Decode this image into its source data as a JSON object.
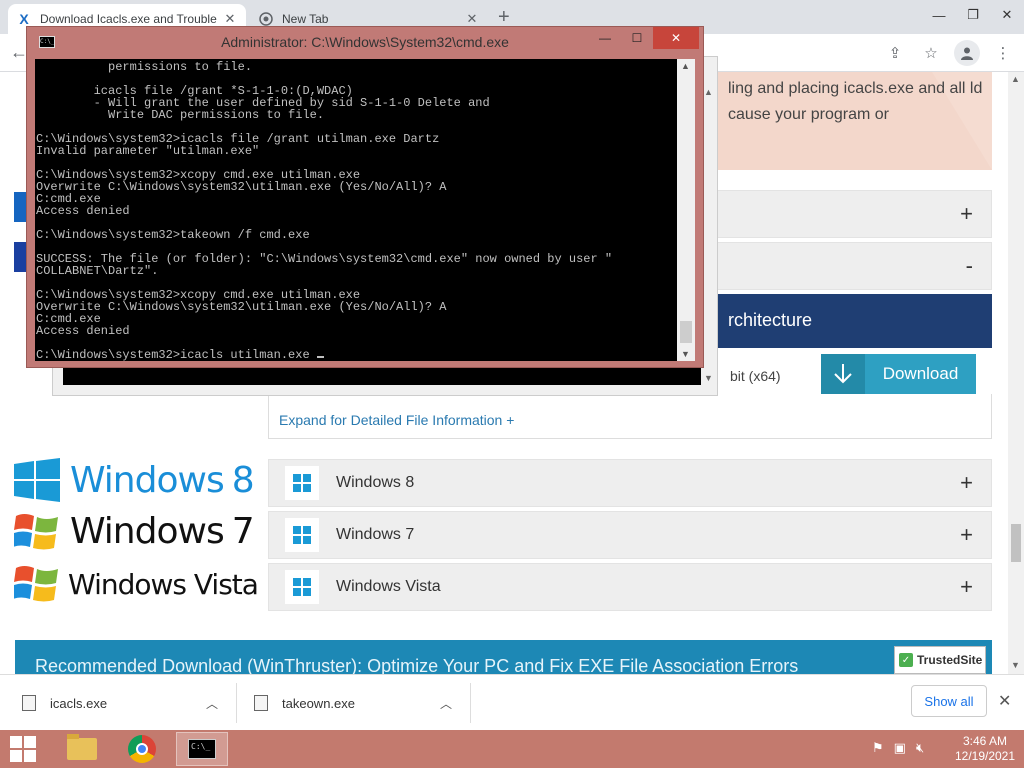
{
  "browser": {
    "tabs": [
      {
        "title": "Download Icacls.exe and Trouble",
        "active": true,
        "favicon": "x-logo-icon"
      },
      {
        "title": "New Tab",
        "active": false,
        "favicon": "chrome-icon"
      }
    ],
    "new_tab_symbol": "+",
    "window_controls": {
      "minimize": "—",
      "restore": "❐",
      "close": "✕"
    }
  },
  "page": {
    "intro_text": "ling and placing icacls.exe and all ld cause your program or",
    "architecture_label": "rchitecture",
    "bit_label": "bit (x64)",
    "download_label": "Download",
    "expand_link": "Expand for Detailed File Information +",
    "accordion": [
      {
        "label": "",
        "sign": "+"
      },
      {
        "label": "",
        "sign": "-"
      },
      {
        "label": "Windows 8",
        "sign": "+"
      },
      {
        "label": "Windows 7",
        "sign": "+"
      },
      {
        "label": "Windows Vista",
        "sign": "+"
      }
    ],
    "brands": [
      {
        "name": "Windows",
        "version": "8"
      },
      {
        "name": "Windows",
        "version": "7"
      },
      {
        "name": "Windows Vista",
        "version": ""
      }
    ],
    "banner_text": "Recommended Download (WinThruster): Optimize Your PC and Fix EXE File Association Errors",
    "trusted_badge": "TrustedSite"
  },
  "cmd": {
    "title": "Administrator: C:\\Windows\\System32\\cmd.exe",
    "icon_text": "C:\\_",
    "lines": [
      "          permissions to file.",
      "",
      "        icacls file /grant *S-1-1-0:(D,WDAC)",
      "        - Will grant the user defined by sid S-1-1-0 Delete and",
      "          Write DAC permissions to file.",
      "",
      "C:\\Windows\\system32>icacls file /grant utilman.exe Dartz",
      "Invalid parameter \"utilman.exe\"",
      "",
      "C:\\Windows\\system32>xcopy cmd.exe utilman.exe",
      "Overwrite C:\\Windows\\system32\\utilman.exe (Yes/No/All)? A",
      "C:cmd.exe",
      "Access denied",
      "",
      "C:\\Windows\\system32>takeown /f cmd.exe",
      "",
      "SUCCESS: The file (or folder): \"C:\\Windows\\system32\\cmd.exe\" now owned by user \"",
      "COLLABNET\\Dartz\".",
      "",
      "C:\\Windows\\system32>xcopy cmd.exe utilman.exe",
      "Overwrite C:\\Windows\\system32\\utilman.exe (Yes/No/All)? A",
      "C:cmd.exe",
      "Access denied",
      "",
      "C:\\Windows\\system32>icacls utilman.exe "
    ]
  },
  "downloads": {
    "items": [
      {
        "name": "icacls.exe"
      },
      {
        "name": "takeown.exe"
      }
    ],
    "show_all": "Show all"
  },
  "taskbar": {
    "time": "3:46 AM",
    "date": "12/19/2021"
  },
  "colors": {
    "taskbar": "#c37a6e",
    "cmd_frame": "#c17a76",
    "download_button": "#2ea0c2",
    "arch_bar": "#1f3e73",
    "banner": "#1d88b5"
  }
}
